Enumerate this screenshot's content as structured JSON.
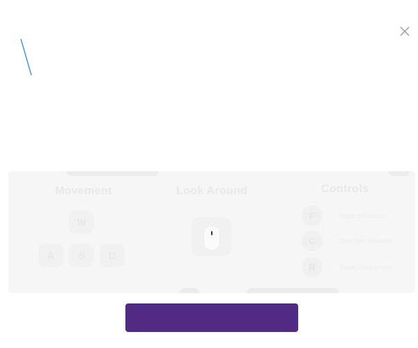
{
  "header": {
    "close_icon": "close-icon"
  },
  "colors": {
    "accent_line": "#1a8fd6",
    "button": "#512a84",
    "panel": "#f6f6f6"
  },
  "movement": {
    "title": "Movement",
    "keys": [
      "W",
      "A",
      "S",
      "D"
    ]
  },
  "look": {
    "title": "Look Around",
    "icon": "mouse-icon"
  },
  "controls": {
    "title": "Controls",
    "items": [
      {
        "key": "F",
        "desc": "Toggle full screen"
      },
      {
        "key": "C",
        "desc": "Clear filter selection"
      },
      {
        "key": "R",
        "desc": "Reset camera view"
      }
    ]
  },
  "start_button": {
    "label": ""
  }
}
